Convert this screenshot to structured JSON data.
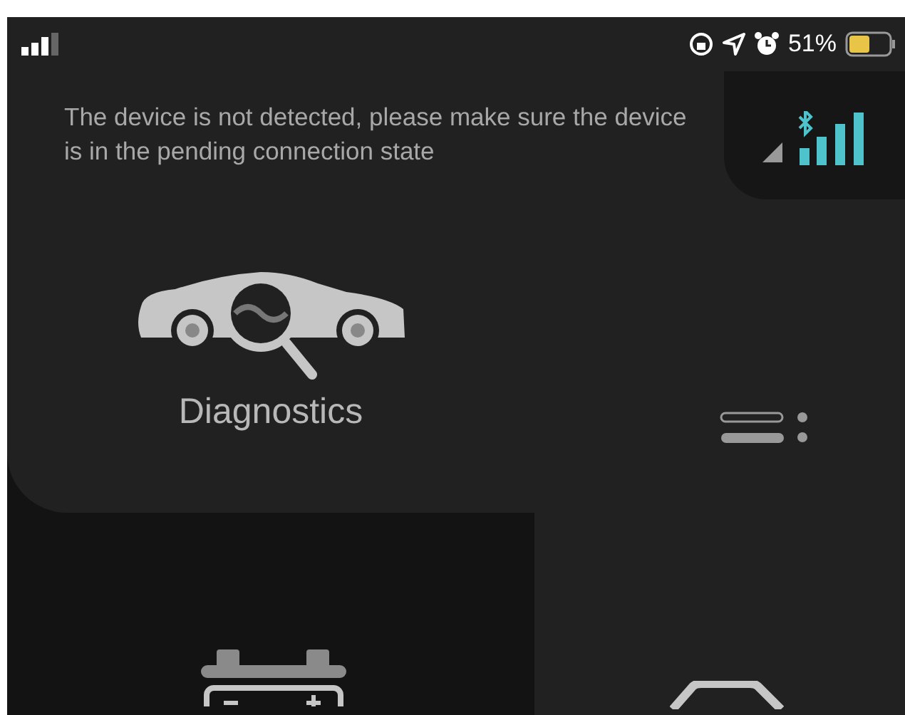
{
  "status_bar": {
    "battery_percent": "51%"
  },
  "message": "The device is not detected, please make sure the device is in the pending connection state",
  "main_feature": {
    "label": "Diagnostics"
  },
  "tiles": [
    {
      "kind": "battery"
    },
    {
      "kind": "car"
    }
  ]
}
